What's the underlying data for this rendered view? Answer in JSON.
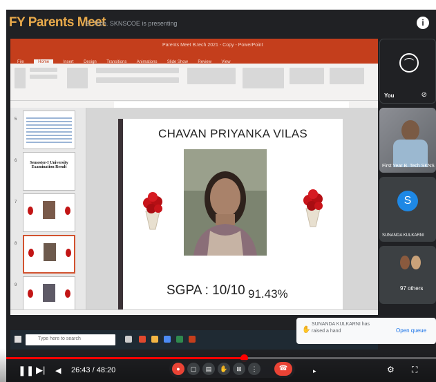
{
  "meet": {
    "title": "FY Parents Meet",
    "presenting": "B. Tech. SKNSCOE is presenting",
    "info_icon": "info-icon"
  },
  "powerpoint": {
    "window_title": "Parents Meet B.tech 2021 - Copy - PowerPoint",
    "tabs": [
      "File",
      "Home",
      "Insert",
      "Design",
      "Transitions",
      "Animations",
      "Slide Show",
      "Review",
      "View"
    ],
    "thumbnails": [
      {
        "number": "5",
        "caption": ""
      },
      {
        "number": "6",
        "caption": "Semester-I University Examination Result"
      },
      {
        "number": "7",
        "caption": ""
      },
      {
        "number": "8",
        "caption": ""
      },
      {
        "number": "9",
        "caption": ""
      }
    ],
    "slide": {
      "student_name": "CHAVAN PRIYANKA VILAS",
      "sgpa": "SGPA : 10/10",
      "percentage": "91.43%"
    },
    "taskbar_search_placeholder": "Type here to search"
  },
  "participants": [
    {
      "name": "You",
      "type": "self"
    },
    {
      "name": "First Year B. Tech SKNS",
      "type": "video"
    },
    {
      "name": "SUNANDA KULKARNI",
      "initial": "S",
      "type": "avatar"
    },
    {
      "name": "97 others",
      "type": "group"
    }
  ],
  "notification": {
    "text": "SUNANDA KULKARNI has raised a hand",
    "action": "Open queue"
  },
  "player": {
    "current_time": "26:43",
    "duration": "48:20",
    "time_display": "26:43 / 48:20",
    "progress": 0.553,
    "colors": {
      "progress": "#ff0000",
      "end_call": "#ea4335"
    }
  }
}
